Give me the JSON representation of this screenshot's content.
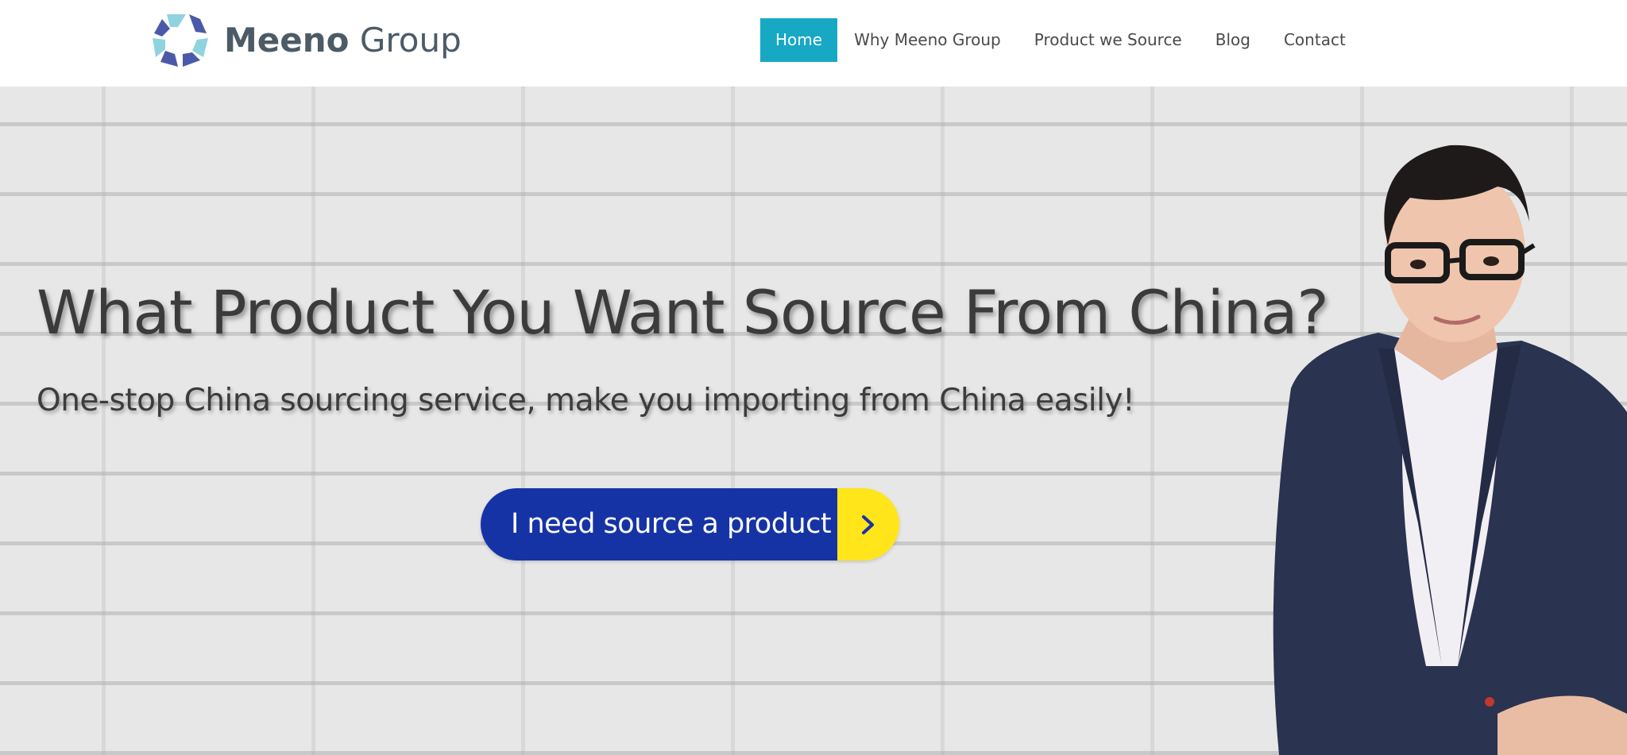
{
  "header": {
    "brand_bold": "Meeno",
    "brand_regular": "Group",
    "logo_icon": "recycle-hexagon-icon"
  },
  "nav": {
    "items": [
      {
        "label": "Home",
        "active": true
      },
      {
        "label": "Why Meeno Group",
        "active": false
      },
      {
        "label": "Product we Source",
        "active": false
      },
      {
        "label": "Blog",
        "active": false
      },
      {
        "label": "Contact",
        "active": false
      }
    ]
  },
  "hero": {
    "title": "What Product You Want Source From China?",
    "subtitle": "One-stop China sourcing service, make you importing from China easily!",
    "cta_label": "I need source a product",
    "cta_icon": "chevron-right-icon",
    "background": "white-brick-wall",
    "image": "man-in-suit-with-glasses"
  },
  "colors": {
    "nav_active": "#17a8c4",
    "cta_primary": "#1633a6",
    "cta_accent": "#ffe51a",
    "brand_text": "#4c5b66"
  }
}
